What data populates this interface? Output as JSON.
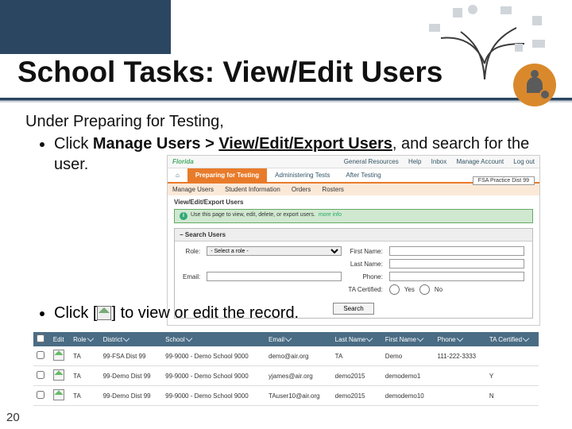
{
  "slide": {
    "title": "School Tasks: View/Edit Users",
    "page_number": "20",
    "intro": "Under Preparing for Testing,",
    "bullet1_prefix": "Click ",
    "bullet1_bold": "Manage Users > ",
    "bullet1_bold_u": "View/Edit/Export Users",
    "bullet1_suffix": ", and search for the user.",
    "bullet2_prefix": "Click [",
    "bullet2_suffix": "]  to view or edit the record."
  },
  "app": {
    "logo": "Florida",
    "top_links": {
      "resources": "General Resources",
      "help": "Help",
      "inbox": "Inbox",
      "manage": "Manage Account",
      "logout": "Log out"
    },
    "tabs": {
      "home_icon": "home",
      "preparing": "Preparing for Testing",
      "admin": "Administering Tests",
      "after": "After Testing"
    },
    "subnav": {
      "manage_users": "Manage Users",
      "student_info": "Student Information",
      "orders": "Orders",
      "rosters": "Rosters"
    },
    "indicator": "FSA Practice Dist 99",
    "page_title": "View/Edit/Export Users",
    "info": "Use this page to view, edit, delete, or export users.",
    "info_more": "more info",
    "search_panel": "Search Users",
    "form": {
      "role_label": "Role:",
      "role_placeholder": "- Select a role -",
      "first_label": "First Name:",
      "last_label": "Last Name:",
      "email_label": "Email:",
      "phone_label": "Phone:",
      "ta_cert_label": "TA Certified:",
      "yes": "Yes",
      "no": "No",
      "search_btn": "Search"
    }
  },
  "results": {
    "headers": {
      "checkbox": "",
      "edit": "Edit",
      "role": "Role",
      "district": "District",
      "school": "School",
      "email": "Email",
      "lastname": "Last Name",
      "firstname": "First Name",
      "phone": "Phone",
      "ta": "TA Certified"
    },
    "rows": [
      {
        "role": "TA",
        "district": "99-FSA Dist 99",
        "school": "99-9000 - Demo School 9000",
        "email": "demo@air.org",
        "lastname": "TA",
        "firstname": "Demo",
        "phone": "111-222-3333",
        "ta": ""
      },
      {
        "role": "TA",
        "district": "99-Demo Dist 99",
        "school": "99-9000 - Demo School 9000",
        "email": "yjames@air.org",
        "lastname": "demo2015",
        "firstname": "demodemo1",
        "phone": "",
        "ta": "Y"
      },
      {
        "role": "TA",
        "district": "99-Demo Dist 99",
        "school": "99-9000 - Demo School 9000",
        "email": "TAuser10@air.org",
        "lastname": "demo2015",
        "firstname": "demodemo10",
        "phone": "",
        "ta": "N"
      }
    ]
  }
}
